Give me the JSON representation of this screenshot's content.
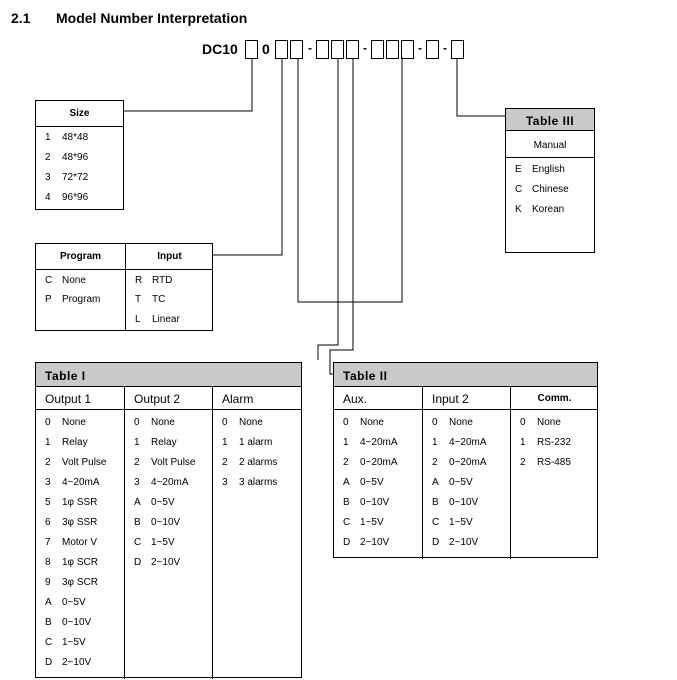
{
  "section": {
    "number": "2.1",
    "title": "Model Number Interpretation"
  },
  "model": {
    "prefix": "DC10",
    "fixed_digit": "0",
    "dashes": [
      "-",
      "-",
      "-",
      "-"
    ]
  },
  "size": {
    "header": "Size",
    "rows": [
      [
        "1",
        "48*48"
      ],
      [
        "2",
        "48*96"
      ],
      [
        "3",
        "72*72"
      ],
      [
        "4",
        "96*96"
      ]
    ]
  },
  "program": {
    "header": "Program",
    "rows": [
      [
        "C",
        "None"
      ],
      [
        "P",
        "Program"
      ]
    ]
  },
  "input": {
    "header": "Input",
    "rows": [
      [
        "R",
        "RTD"
      ],
      [
        "T",
        "TC"
      ],
      [
        "L",
        "Linear"
      ]
    ]
  },
  "table3": {
    "title": "Table III",
    "header": "Manual",
    "rows": [
      [
        "E",
        "English"
      ],
      [
        "C",
        "Chinese"
      ],
      [
        "K",
        "Korean"
      ]
    ]
  },
  "table1": {
    "title": "Table I",
    "headers": [
      "Output 1",
      "Output 2",
      "Alarm"
    ],
    "output1": [
      [
        "0",
        "None"
      ],
      [
        "1",
        "Relay"
      ],
      [
        "2",
        "Volt Pulse"
      ],
      [
        "3",
        "4~20mA"
      ],
      [
        "5",
        "1φ SSR"
      ],
      [
        "6",
        "3φ SSR"
      ],
      [
        "7",
        "Motor V"
      ],
      [
        "8",
        "1φ SCR"
      ],
      [
        "9",
        "3φ SCR"
      ],
      [
        "A",
        "0~5V"
      ],
      [
        "B",
        "0~10V"
      ],
      [
        "C",
        "1~5V"
      ],
      [
        "D",
        "2~10V"
      ]
    ],
    "output2": [
      [
        "0",
        "None"
      ],
      [
        "1",
        "Relay"
      ],
      [
        "2",
        "Volt Pulse"
      ],
      [
        "3",
        "4~20mA"
      ],
      [
        "A",
        "0~5V"
      ],
      [
        "B",
        "0~10V"
      ],
      [
        "C",
        "1~5V"
      ],
      [
        "D",
        "2~10V"
      ]
    ],
    "alarm": [
      [
        "0",
        "None"
      ],
      [
        "1",
        "1 alarm"
      ],
      [
        "2",
        "2 alarms"
      ],
      [
        "3",
        "3 alarms"
      ]
    ]
  },
  "table2": {
    "title": "Table II",
    "headers": [
      "Aux.",
      "Input 2",
      "Comm."
    ],
    "aux": [
      [
        "0",
        "None"
      ],
      [
        "1",
        "4~20mA"
      ],
      [
        "2",
        "0~20mA"
      ],
      [
        "A",
        "0~5V"
      ],
      [
        "B",
        "0~10V"
      ],
      [
        "C",
        "1~5V"
      ],
      [
        "D",
        "2~10V"
      ]
    ],
    "input2": [
      [
        "0",
        "None"
      ],
      [
        "1",
        "4~20mA"
      ],
      [
        "2",
        "0~20mA"
      ],
      [
        "A",
        "0~5V"
      ],
      [
        "B",
        "0~10V"
      ],
      [
        "C",
        "1~5V"
      ],
      [
        "D",
        "2~10V"
      ]
    ],
    "comm": [
      [
        "0",
        "None"
      ],
      [
        "1",
        "RS-232"
      ],
      [
        "2",
        "RS-485"
      ]
    ]
  }
}
